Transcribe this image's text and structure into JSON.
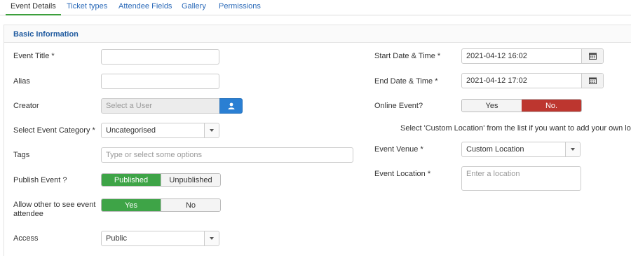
{
  "tabs": [
    {
      "label": "Event Details"
    },
    {
      "label": "Ticket types"
    },
    {
      "label": "Attendee Fields"
    },
    {
      "label": "Gallery"
    },
    {
      "label": "Permissions"
    }
  ],
  "panel": {
    "title": "Basic Information"
  },
  "form": {
    "event_title": {
      "label": "Event Title *",
      "value": ""
    },
    "alias": {
      "label": "Alias",
      "value": ""
    },
    "creator": {
      "label": "Creator",
      "placeholder": "Select a User",
      "icon": "user-icon"
    },
    "category": {
      "label": "Select Event Category *",
      "value": "Uncategorised"
    },
    "tags": {
      "label": "Tags",
      "placeholder": "Type or select some options"
    },
    "publish": {
      "label": "Publish Event ?",
      "options": [
        "Published",
        "Unpublished"
      ],
      "selected": "Published"
    },
    "allow_see": {
      "label": "Allow other to see event attendee",
      "options": [
        "Yes",
        "No"
      ],
      "selected": "Yes"
    },
    "access": {
      "label": "Access",
      "value": "Public"
    },
    "start": {
      "label": "Start Date & Time *",
      "value": "2021-04-12 16:02",
      "icon": "calendar-icon"
    },
    "end": {
      "label": "End Date & Time *",
      "value": "2021-04-12 17:02",
      "icon": "calendar-icon"
    },
    "online": {
      "label": "Online Event?",
      "options": [
        "Yes",
        "No."
      ],
      "selected": "No."
    },
    "location_note": "Select 'Custom Location' from the list if you want to add your own location",
    "venue": {
      "label": "Event Venue *",
      "value": "Custom Location"
    },
    "location": {
      "label": "Event Location *",
      "placeholder": "Enter a location"
    }
  },
  "colors": {
    "accent": "#2a69b8",
    "green": "#3ea447",
    "red": "#bd362f",
    "blue_button": "#2a7fd3"
  }
}
